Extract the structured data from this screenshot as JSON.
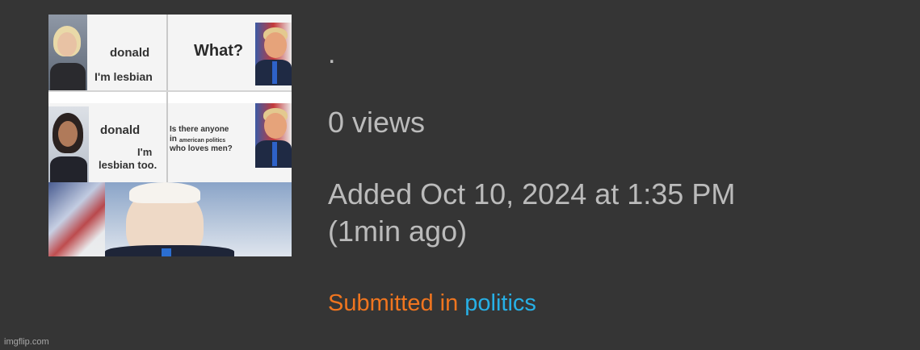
{
  "thumbnail": {
    "panels": {
      "top_left_text_1": "donald",
      "top_left_text_2": "I'm lesbian",
      "top_right_text": "What?",
      "mid_left_text_1": "donald",
      "mid_left_text_2": "I'm",
      "mid_left_text_3": "lesbian too.",
      "mid_right_text_1": "Is there anyone",
      "mid_right_text_2": "in",
      "mid_right_text_3": "american politics",
      "mid_right_text_4": "who loves men?"
    }
  },
  "post": {
    "title": ".",
    "views": "0 views",
    "added_line_1": "Added Oct 10, 2024 at 1:35 PM",
    "added_line_2": "(1min ago)",
    "submitted_prefix": "Submitted in",
    "category": "politics"
  },
  "watermark": "imgflip.com",
  "colors": {
    "background": "#353535",
    "text": "#bbbbbb",
    "submitted": "#f0751f",
    "category_link": "#27b0e6"
  }
}
